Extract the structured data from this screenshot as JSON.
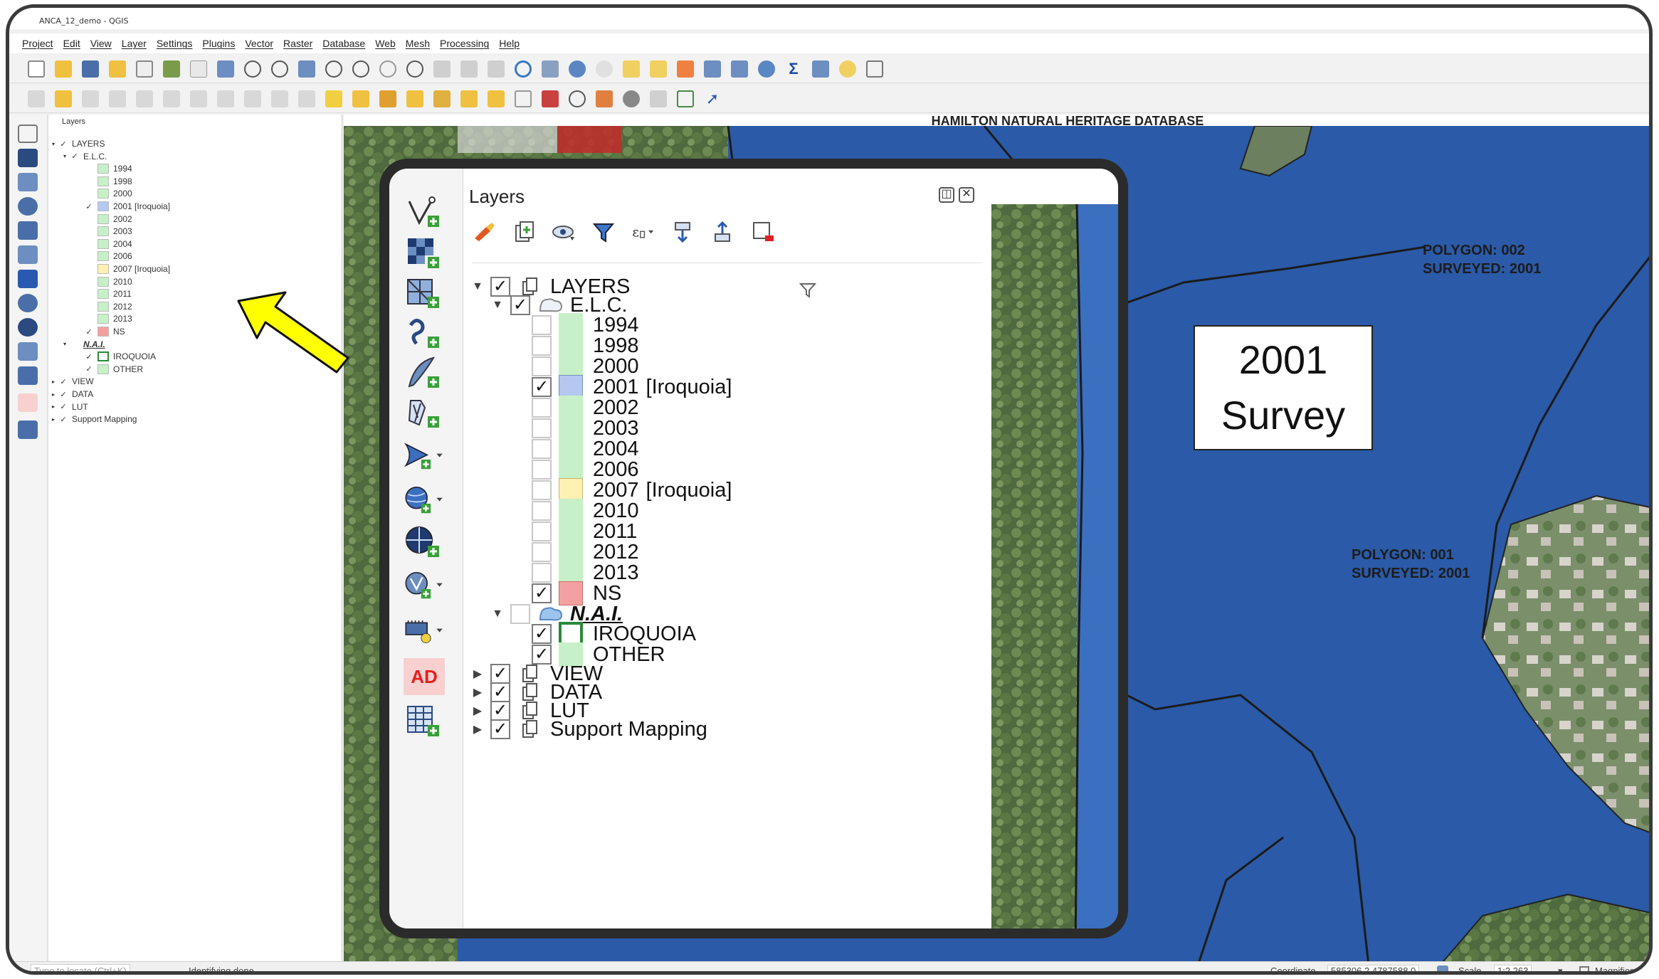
{
  "window": {
    "title": "ANCA_12_demo - QGIS"
  },
  "menu": [
    "Project",
    "Edit",
    "View",
    "Layer",
    "Settings",
    "Plugins",
    "Vector",
    "Raster",
    "Database",
    "Web",
    "Mesh",
    "Processing",
    "Help"
  ],
  "small_panel": {
    "title": "Layers",
    "rows": [
      {
        "label": "LAYERS",
        "checked": true,
        "kind": "group"
      },
      {
        "label": "E.L.C.",
        "checked": true,
        "kind": "subgroup"
      },
      {
        "label": "1994",
        "checked": false,
        "color": "#c8f0c8"
      },
      {
        "label": "1998",
        "checked": false,
        "color": "#c8f0c8"
      },
      {
        "label": "2000",
        "checked": false,
        "color": "#c8f0c8"
      },
      {
        "label": "2001  [Iroquoia]",
        "checked": true,
        "color": "#b4c8f0"
      },
      {
        "label": "2002",
        "checked": false,
        "color": "#c8f0c8"
      },
      {
        "label": "2003",
        "checked": false,
        "color": "#c8f0c8"
      },
      {
        "label": "2004",
        "checked": false,
        "color": "#c8f0c8"
      },
      {
        "label": "2006",
        "checked": false,
        "color": "#c8f0c8"
      },
      {
        "label": "2007  [Iroquoia]",
        "checked": false,
        "color": "#fff0b4"
      },
      {
        "label": "2010",
        "checked": false,
        "color": "#c8f0c8"
      },
      {
        "label": "2011",
        "checked": false,
        "color": "#c8f0c8"
      },
      {
        "label": "2012",
        "checked": false,
        "color": "#c8f0c8"
      },
      {
        "label": "2013",
        "checked": false,
        "color": "#c8f0c8"
      },
      {
        "label": "NS",
        "checked": true,
        "color": "#f4a0a0"
      },
      {
        "label": "N.A.I.",
        "checked": false,
        "kind": "subgroup"
      },
      {
        "label": "IROQUOIA",
        "checked": true,
        "color": "outline"
      },
      {
        "label": "OTHER",
        "checked": true,
        "color": "#c8f0c8"
      },
      {
        "label": "VIEW",
        "checked": true,
        "kind": "group"
      },
      {
        "label": "DATA",
        "checked": true,
        "kind": "group"
      },
      {
        "label": "LUT",
        "checked": true,
        "kind": "group"
      },
      {
        "label": "Support Mapping",
        "checked": true,
        "kind": "group"
      }
    ]
  },
  "map": {
    "header": "HAMILTON NATURAL HERITAGE DATABASE",
    "callout_line1": "2001",
    "callout_line2": "Survey",
    "polygon_002_line1": "POLYGON: 002",
    "polygon_002_line2": "SURVEYED: 2001",
    "polygon_001_line1": "POLYGON: 001",
    "polygon_001_line2": "SURVEYED: 2001"
  },
  "inset": {
    "panel_title": "Layers",
    "ad_label": "AD",
    "tree": {
      "layers": "LAYERS",
      "elc": "E.L.C.",
      "y1994": "1994",
      "y1998": "1998",
      "y2000": "2000",
      "y2001": "2001",
      "y2001_tag": "[Iroquoia]",
      "y2002": "2002",
      "y2003": "2003",
      "y2004": "2004",
      "y2006": "2006",
      "y2007": "2007",
      "y2007_tag": "[Iroquoia]",
      "y2010": "2010",
      "y2011": "2011",
      "y2012": "2012",
      "y2013": "2013",
      "ns": "NS",
      "nai": "N.A.I.",
      "iroquoia": "IROQUOIA",
      "other": "OTHER",
      "view": "VIEW",
      "data": "DATA",
      "lut": "LUT",
      "support": "Support Mapping"
    }
  },
  "statusbar": {
    "locate_placeholder": "Type to locate (Ctrl+K)",
    "message": "Identifying done.",
    "coordinate_label": "Coordinate",
    "coordinate_value": "585306.2,4787588.0",
    "scale_label": "Scale",
    "scale_value": "1:2,263",
    "magnifier_label": "Magnifier"
  },
  "colors": {
    "map_blue": "#2b5aa8",
    "elc_green": "#c8f0c8",
    "survey_2001": "#b4c8f0",
    "survey_2007": "#fff0b4",
    "ns_red": "#f4a0a0",
    "arrow_yellow": "#ffff00"
  }
}
